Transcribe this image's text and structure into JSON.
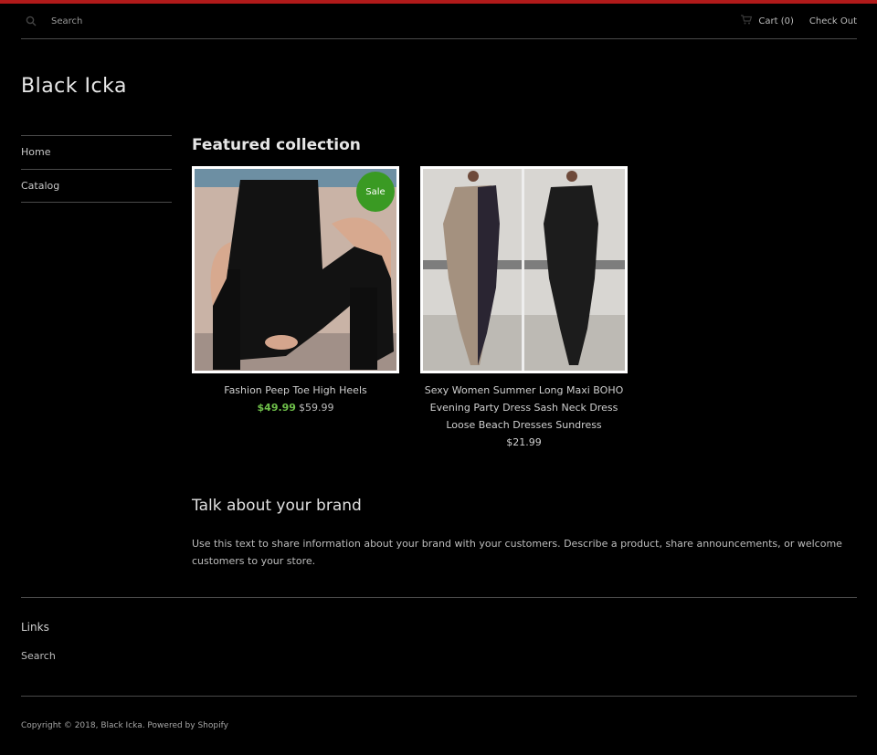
{
  "header": {
    "search_placeholder": "Search",
    "cart_label": "Cart (0)",
    "checkout_label": "Check Out"
  },
  "store": {
    "name": "Black Icka"
  },
  "nav": {
    "items": [
      {
        "label": "Home"
      },
      {
        "label": "Catalog"
      }
    ]
  },
  "featured": {
    "title": "Featured collection",
    "products": [
      {
        "title": "Fashion Peep Toe High Heels",
        "price": "$49.99",
        "compare_price": "$59.99",
        "badge": "Sale"
      },
      {
        "title": "Sexy Women Summer Long Maxi BOHO Evening Party Dress Sash Neck Dress Loose Beach Dresses Sundress",
        "price": "$21.99"
      }
    ]
  },
  "about": {
    "title": "Talk about your brand",
    "text": "Use this text to share information about your brand with your customers. Describe a product, share announcements, or welcome customers to your store."
  },
  "footer": {
    "links_title": "Links",
    "search_link": "Search",
    "copyright": "Copyright © 2018, Black Icka. Powered by Shopify"
  },
  "colors": {
    "accent_bar": "#b11a1a",
    "sale_badge": "#3a9a23",
    "sale_price": "#6fc04a",
    "background": "#000000"
  },
  "icons": {
    "search": "search-icon",
    "cart": "cart-icon"
  }
}
